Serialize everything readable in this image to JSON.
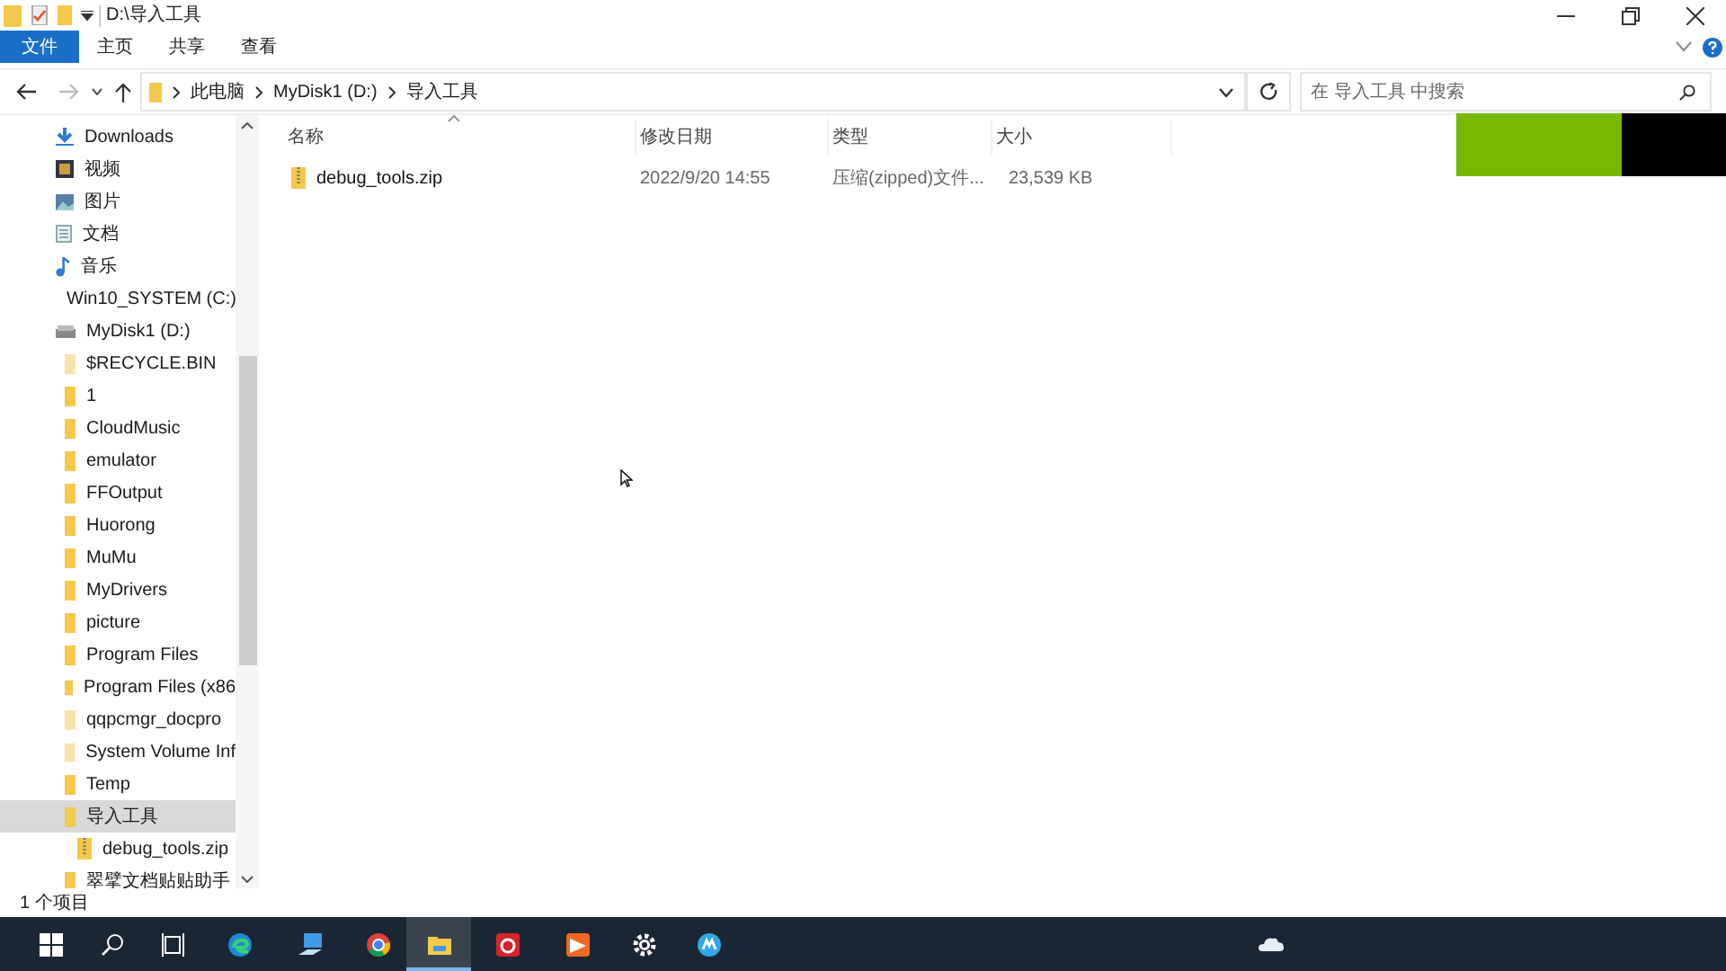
{
  "window": {
    "title": "D:\\导入工具"
  },
  "ribbon_tabs": [
    {
      "label": "文件",
      "selected": true
    },
    {
      "label": "主页",
      "selected": false
    },
    {
      "label": "共享",
      "selected": false
    },
    {
      "label": "查看",
      "selected": false
    }
  ],
  "address": {
    "crumbs": [
      "此电脑",
      "MyDisk1 (D:)",
      "导入工具"
    ]
  },
  "search": {
    "placeholder": "在 导入工具 中搜索"
  },
  "sidebar": {
    "items": [
      {
        "label": "Downloads",
        "kind": "download",
        "selected": false
      },
      {
        "label": "视频",
        "kind": "video",
        "selected": false
      },
      {
        "label": "图片",
        "kind": "image",
        "selected": false
      },
      {
        "label": "文档",
        "kind": "doc",
        "selected": false
      },
      {
        "label": "音乐",
        "kind": "music",
        "selected": false
      },
      {
        "label": "Win10_SYSTEM (C:)",
        "kind": "drive",
        "selected": false
      },
      {
        "label": "MyDisk1 (D:)",
        "kind": "drive",
        "selected": false,
        "children": [
          {
            "label": "$RECYCLE.BIN",
            "kind": "faded-folder",
            "selected": false
          },
          {
            "label": "1",
            "kind": "folder",
            "selected": false
          },
          {
            "label": "CloudMusic",
            "kind": "folder",
            "selected": false
          },
          {
            "label": "emulator",
            "kind": "folder",
            "selected": false
          },
          {
            "label": "FFOutput",
            "kind": "folder",
            "selected": false
          },
          {
            "label": "Huorong",
            "kind": "folder",
            "selected": false
          },
          {
            "label": "MuMu",
            "kind": "folder",
            "selected": false
          },
          {
            "label": "MyDrivers",
            "kind": "folder",
            "selected": false
          },
          {
            "label": "picture",
            "kind": "folder",
            "selected": false
          },
          {
            "label": "Program Files",
            "kind": "folder",
            "selected": false
          },
          {
            "label": "Program Files (x86",
            "kind": "folder",
            "selected": false
          },
          {
            "label": "qqpcmgr_docpro",
            "kind": "faded-folder",
            "selected": false
          },
          {
            "label": "System Volume Inf",
            "kind": "faded-folder",
            "selected": false
          },
          {
            "label": "Temp",
            "kind": "folder",
            "selected": false
          },
          {
            "label": "导入工具",
            "kind": "folder",
            "selected": true,
            "children": [
              {
                "label": "debug_tools.zip",
                "kind": "zip",
                "selected": false
              }
            ]
          },
          {
            "label": "翠擘文档贴贴助手",
            "kind": "folder",
            "selected": false
          }
        ]
      }
    ]
  },
  "table": {
    "columns": [
      "名称",
      "修改日期",
      "类型",
      "大小"
    ],
    "rows": [
      {
        "cells": [
          "debug_tools.zip",
          "2022/9/20 14:55",
          "压缩(zipped)文件...",
          "23,539 KB"
        ],
        "selected": false
      }
    ]
  },
  "status_bar": "1 个项目",
  "taskbar": {
    "apps": [
      {
        "kind": "start",
        "active": false
      },
      {
        "kind": "search",
        "active": false
      },
      {
        "kind": "taskview",
        "active": false
      },
      {
        "kind": "edge",
        "active": false
      },
      {
        "kind": "pc",
        "active": false
      },
      {
        "kind": "chrome",
        "active": false
      },
      {
        "kind": "explorer",
        "active": true
      },
      {
        "kind": "music",
        "active": false
      },
      {
        "kind": "orange",
        "active": false
      },
      {
        "kind": "settings",
        "active": false
      },
      {
        "kind": "blue",
        "active": false
      }
    ]
  }
}
